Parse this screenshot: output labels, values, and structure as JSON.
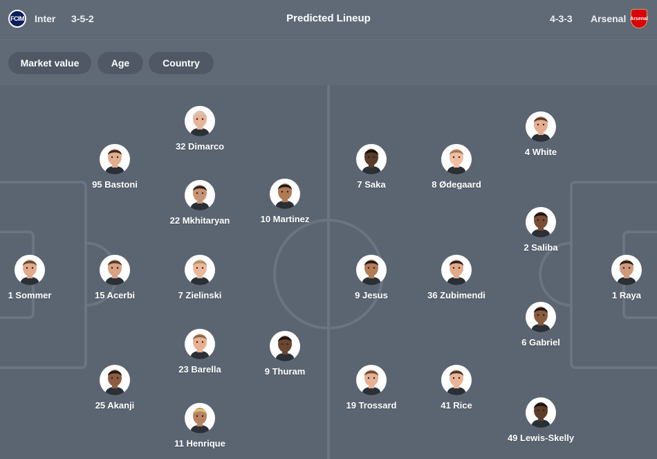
{
  "header": {
    "home_team": "Inter",
    "home_formation": "3-5-2",
    "title": "Predicted Lineup",
    "away_formation": "4-3-3",
    "away_team": "Arsenal",
    "home_logo_text": "FCIM",
    "away_logo_text": "Arsenal"
  },
  "filters": [
    "Market value",
    "Age",
    "Country"
  ],
  "colors": {
    "background": "#5b6572",
    "pitch_lines": "#6b7480",
    "inter_blue": "#0c1f5c",
    "arsenal_red": "#db0007"
  },
  "home_players": [
    {
      "label": "32 Dimarco",
      "skin": "#e6b49a",
      "hair": "#d9c4b0"
    },
    {
      "label": "95 Bastoni",
      "skin": "#e3ad8f",
      "hair": "#3a2a22"
    },
    {
      "label": "22 Mkhitaryan",
      "skin": "#c89374",
      "hair": "#2d2320"
    },
    {
      "label": "10 Martinez",
      "skin": "#b07a55",
      "hair": "#1f1a17"
    },
    {
      "label": "1 Sommer",
      "skin": "#e0a98b",
      "hair": "#6b4a32"
    },
    {
      "label": "15 Acerbi",
      "skin": "#d8a283",
      "hair": "#4a3a2e"
    },
    {
      "label": "7 Zielinski",
      "skin": "#ecb79b",
      "hair": "#b58f64"
    },
    {
      "label": "23 Barella",
      "skin": "#e8b093",
      "hair": "#8a6a48"
    },
    {
      "label": "9 Thuram",
      "skin": "#6b4632",
      "hair": "#1a1412"
    },
    {
      "label": "25 Akanji",
      "skin": "#8e5c42",
      "hair": "#1e1714"
    },
    {
      "label": "11 Henrique",
      "skin": "#b98260",
      "hair": "#d8c07a"
    }
  ],
  "away_players": [
    {
      "label": "4 White",
      "skin": "#e4ad90",
      "hair": "#5a3b28"
    },
    {
      "label": "7 Saka",
      "skin": "#5a3a28",
      "hair": "#161210"
    },
    {
      "label": "8 Ødegaard",
      "skin": "#efbea2",
      "hair": "#a07a55"
    },
    {
      "label": "2 Saliba",
      "skin": "#7a4e36",
      "hair": "#1a1412"
    },
    {
      "label": "9 Jesus",
      "skin": "#b37c58",
      "hair": "#1f1a17"
    },
    {
      "label": "36 Zubimendi",
      "skin": "#e2aa8b",
      "hair": "#2b211c"
    },
    {
      "label": "1 Raya",
      "skin": "#d09a7a",
      "hair": "#2a201b"
    },
    {
      "label": "6 Gabriel",
      "skin": "#8a5a3e",
      "hair": "#171210"
    },
    {
      "label": "19 Trossard",
      "skin": "#e7b093",
      "hair": "#6a4c36"
    },
    {
      "label": "41 Rice",
      "skin": "#e9b497",
      "hair": "#4b3426"
    },
    {
      "label": "49 Lewis-Skelly",
      "skin": "#5e3c2a",
      "hair": "#161210"
    }
  ]
}
